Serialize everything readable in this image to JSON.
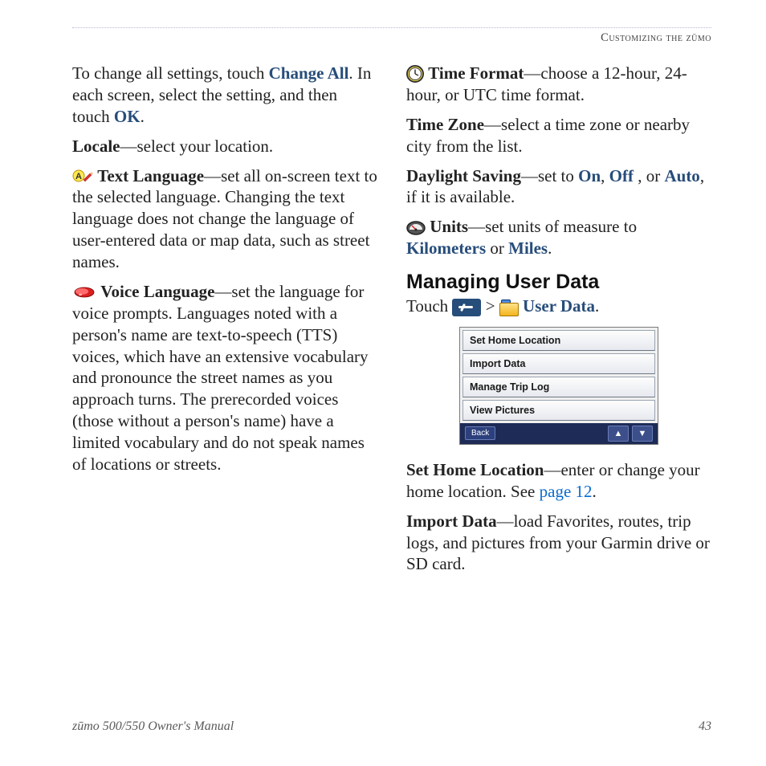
{
  "header": {
    "title": "Customizing the zūmo"
  },
  "left": {
    "p1": {
      "pre": "To change all settings, touch ",
      "change_all": "Change All",
      "mid": ". In each screen, select the setting, and then touch ",
      "ok": "OK",
      "post": "."
    },
    "locale": {
      "label": "Locale",
      "text": "—select your location."
    },
    "text_lang": {
      "label": "Text Language",
      "text": "—set all on-screen text to the selected language. Changing the text language does not change the language of user-entered data or map data, such as street names."
    },
    "voice_lang": {
      "label": "Voice Language",
      "text": "—set the language for voice prompts. Languages noted with a person's name are text-to-speech (TTS) voices, which have an extensive vocabulary and pronounce the street names as you approach turns. The prerecorded voices (those without a person's name) have a limited vocabulary and do not speak names of locations or streets."
    }
  },
  "right": {
    "time_format": {
      "label": "Time Format",
      "text": "—choose a 12-hour, 24-hour, or UTC time format."
    },
    "time_zone": {
      "label": "Time Zone",
      "text": "—select a time zone or nearby city from the list."
    },
    "daylight": {
      "label": "Daylight Saving",
      "pre": "—set to ",
      "on": "On",
      "sep1": ", ",
      "off": "Off",
      "sep2": " , or ",
      "auto": "Auto",
      "post": ", if it is available."
    },
    "units": {
      "label": "Units",
      "pre": "—set units of measure to ",
      "km": "Kilometers",
      "sep": " or ",
      "mi": "Miles",
      "post": "."
    },
    "section_title": "Managing User Data",
    "touch": {
      "pre": "Touch ",
      "gt": ">",
      "user_data": "User Data",
      "post": "."
    },
    "menu": {
      "items": [
        "Set Home Location",
        "Import Data",
        "Manage Trip Log",
        "View Pictures"
      ],
      "back": "Back"
    },
    "set_home": {
      "label": "Set Home Location",
      "pre": "—enter or change your home location. See ",
      "link": "page 12",
      "post": "."
    },
    "import": {
      "label": "Import Data",
      "text": "—load Favorites, routes, trip logs, and pictures from your Garmin drive or SD card."
    }
  },
  "footer": {
    "left": "zūmo 500/550 Owner's Manual",
    "right": "43"
  }
}
